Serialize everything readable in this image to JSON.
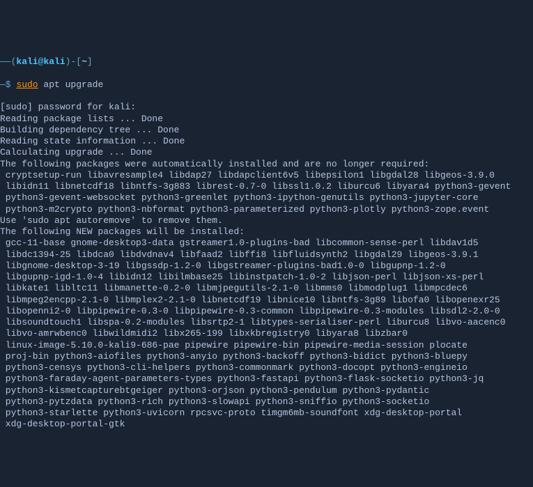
{
  "prompt": {
    "user": "kali",
    "at": "@",
    "host": "kali",
    "path": "~",
    "dash_prefix": "——(",
    "dash_suffix": ")-[",
    "close_bracket": "]",
    "dollar": "—$ ",
    "sudo": "sudo",
    "command": " apt upgrade"
  },
  "output": {
    "line1": "[sudo] password for kali:",
    "line2": "Reading package lists ... Done",
    "line3": "Building dependency tree ... Done",
    "line4": "Reading state information ... Done",
    "line5": "Calculating upgrade ... Done",
    "line6": "The following packages were automatically installed and are no longer required:",
    "auto_pkg1": " cryptsetup-run libavresample4 libdap27 libdapclient6v5 libepsilon1 libgdal28 libgeos-3.9.0",
    "auto_pkg2": " libidn11 libnetcdf18 libntfs-3g883 librest-0.7-0 libssl1.0.2 liburcu6 libyara4 python3-gevent",
    "auto_pkg3": " python3-gevent-websocket python3-greenlet python3-ipython-genutils python3-jupyter-core",
    "auto_pkg4": " python3-m2crypto python3-nbformat python3-parameterized python3-plotly python3-zope.event",
    "line7": "Use 'sudo apt autoremove' to remove them.",
    "line8": "The following NEW packages will be installed:",
    "new_pkg1": " gcc-11-base gnome-desktop3-data gstreamer1.0-plugins-bad libcommon-sense-perl libdav1d5",
    "new_pkg2": " libdc1394-25 libdca0 libdvdnav4 libfaad2 libffi8 libfluidsynth2 libgdal29 libgeos-3.9.1",
    "new_pkg3": " libgnome-desktop-3-19 libgssdp-1.2-0 libgstreamer-plugins-bad1.0-0 libgupnp-1.2-0",
    "new_pkg4": " libgupnp-igd-1.0-4 libidn12 libilmbase25 libinstpatch-1.0-2 libjson-perl libjson-xs-perl",
    "new_pkg5": " libkate1 libltc11 libmanette-0.2-0 libmjpegutils-2.1-0 libmms0 libmodplug1 libmpcdec6",
    "new_pkg6": " libmpeg2encpp-2.1-0 libmplex2-2.1-0 libnetcdf19 libnice10 libntfs-3g89 libofa0 libopenexr25",
    "new_pkg7": " libopenni2-0 libpipewire-0.3-0 libpipewire-0.3-common libpipewire-0.3-modules libsdl2-2.0-0",
    "new_pkg8": " libsoundtouch1 libspa-0.2-modules libsrtp2-1 libtypes-serialiser-perl liburcu8 libvo-aacenc0",
    "new_pkg9": " libvo-amrwbenc0 libwildmidi2 libx265-199 libxkbregistry0 libyara8 libzbar0",
    "new_pkg10": " linux-image-5.10.0-kali9-686-pae pipewire pipewire-bin pipewire-media-session plocate",
    "new_pkg11": " proj-bin python3-aiofiles python3-anyio python3-backoff python3-bidict python3-bluepy",
    "new_pkg12": " python3-censys python3-cli-helpers python3-commonmark python3-docopt python3-engineio",
    "new_pkg13": " python3-faraday-agent-parameters-types python3-fastapi python3-flask-socketio python3-jq",
    "new_pkg14": " python3-kismetcapturebtgeiger python3-orjson python3-pendulum python3-pydantic",
    "new_pkg15": " python3-pytzdata python3-rich python3-slowapi python3-sniffio python3-socketio",
    "new_pkg16": " python3-starlette python3-uvicorn rpcsvc-proto timgm6mb-soundfont xdg-desktop-portal",
    "new_pkg17": " xdg-desktop-portal-gtk"
  }
}
